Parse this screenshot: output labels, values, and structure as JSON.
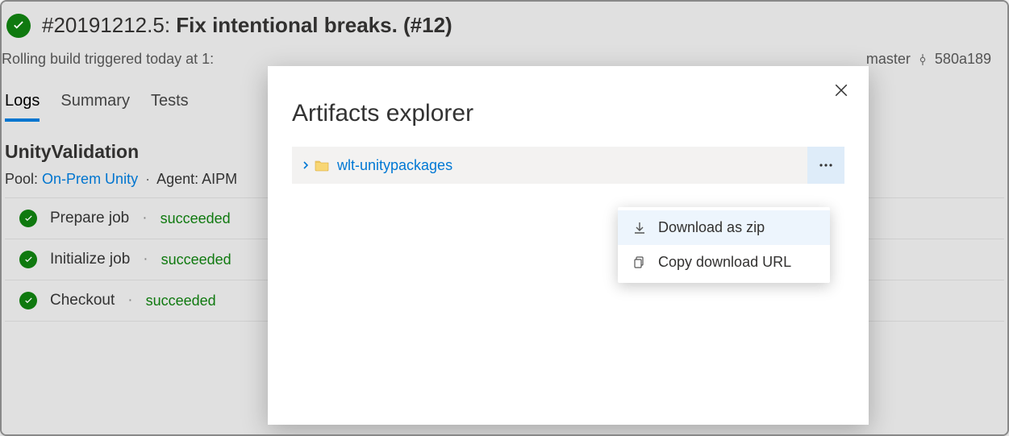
{
  "header": {
    "build_id": "#20191212.5:",
    "build_title": "Fix intentional breaks. (#12)",
    "subtitle_left": "Rolling build triggered today at 1:",
    "branch": "master",
    "commit": "580a189"
  },
  "tabs": [
    {
      "label": "Logs",
      "active": true
    },
    {
      "label": "Summary",
      "active": false
    },
    {
      "label": "Tests",
      "active": false
    }
  ],
  "job": {
    "title": "UnityValidation",
    "pool_label": "Pool:",
    "pool_name": "On-Prem Unity",
    "agent_label": "Agent: AIPM"
  },
  "steps": [
    {
      "name": "Prepare job",
      "status": "succeeded"
    },
    {
      "name": "Initialize job",
      "status": "succeeded"
    },
    {
      "name": "Checkout",
      "status": "succeeded"
    }
  ],
  "modal": {
    "title": "Artifacts explorer",
    "artifact_name": "wlt-unitypackages"
  },
  "ctx": {
    "download": "Download as zip",
    "copy": "Copy download URL"
  }
}
